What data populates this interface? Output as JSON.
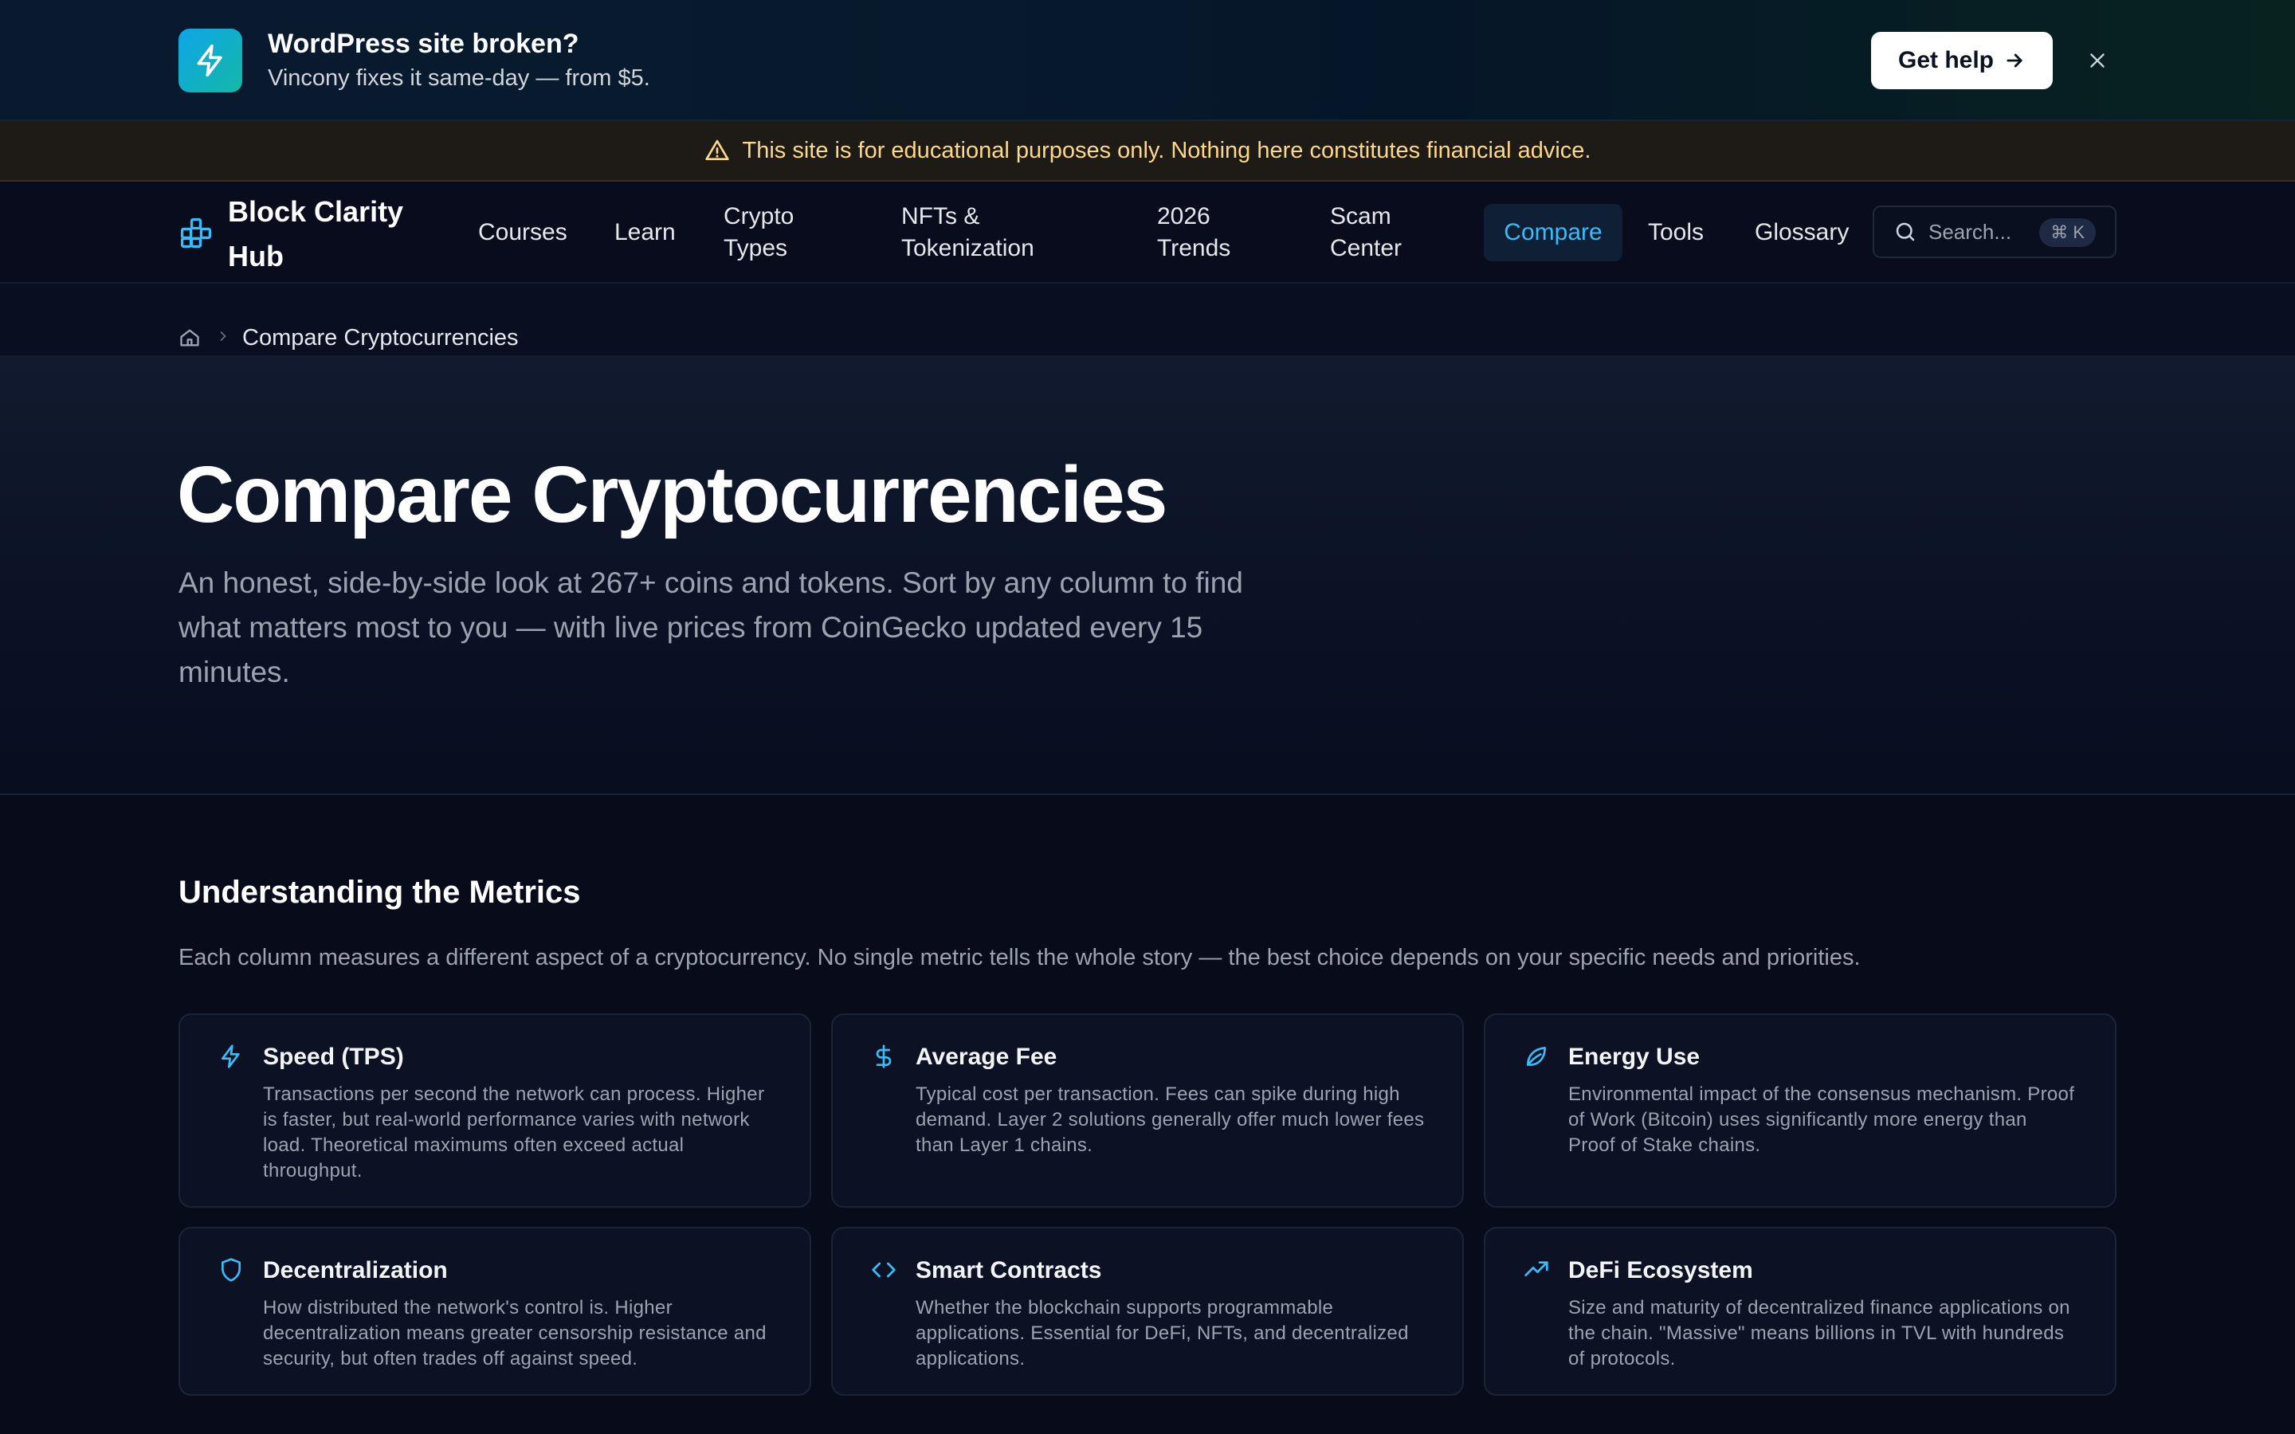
{
  "promo": {
    "icon": "lightning-icon",
    "title": "WordPress site broken?",
    "subtitle": "Vincony fixes it same-day — from $5.",
    "button_label": "Get help",
    "accent": "#0ea5e9"
  },
  "disclaimer": {
    "icon": "warning-icon",
    "text": "This site is for educational purposes only. Nothing here constitutes financial advice.",
    "color": "#fcd88a"
  },
  "nav": {
    "logo_text": "Block Clarity Hub",
    "items": [
      "Courses",
      "Learn",
      "Crypto Types",
      "NFTs & Tokenization",
      "2026 Trends",
      "Scam Center",
      "Compare",
      "Tools",
      "Glossary"
    ],
    "active": "Compare",
    "search_placeholder": "Search...",
    "search_shortcut": "⌘ K",
    "accent": "#38bdf8"
  },
  "breadcrumb": {
    "home_icon": "home-icon",
    "current": "Compare Cryptocurrencies"
  },
  "hero": {
    "title": "Compare Cryptocurrencies",
    "description": "An honest, side-by-side look at 267+ coins and tokens. Sort by any column to find what matters most to you — with live prices from CoinGecko updated every 15 minutes."
  },
  "metrics": {
    "title": "Understanding the Metrics",
    "description": "Each column measures a different aspect of a cryptocurrency. No single metric tells the whole story — the best choice depends on your specific needs and priorities.",
    "cards": [
      {
        "icon": "lightning-icon",
        "title": "Speed (TPS)",
        "desc": "Transactions per second the network can process. Higher is faster, but real-world performance varies with network load. Theoretical maximums often exceed actual throughput."
      },
      {
        "icon": "dollar-icon",
        "title": "Average Fee",
        "desc": "Typical cost per transaction. Fees can spike during high demand. Layer 2 solutions generally offer much lower fees than Layer 1 chains."
      },
      {
        "icon": "leaf-icon",
        "title": "Energy Use",
        "desc": "Environmental impact of the consensus mechanism. Proof of Work (Bitcoin) uses significantly more energy than Proof of Stake chains."
      },
      {
        "icon": "shield-icon",
        "title": "Decentralization",
        "desc": "How distributed the network's control is. Higher decentralization means greater censorship resistance and security, but often trades off against speed."
      },
      {
        "icon": "code-icon",
        "title": "Smart Contracts",
        "desc": "Whether the blockchain supports programmable applications. Essential for DeFi, NFTs, and decentralized applications."
      },
      {
        "icon": "trending-up-icon",
        "title": "DeFi Ecosystem",
        "desc": "Size and maturity of decentralized finance applications on the chain. \"Massive\" means billions in TVL with hundreds of protocols."
      }
    ]
  }
}
